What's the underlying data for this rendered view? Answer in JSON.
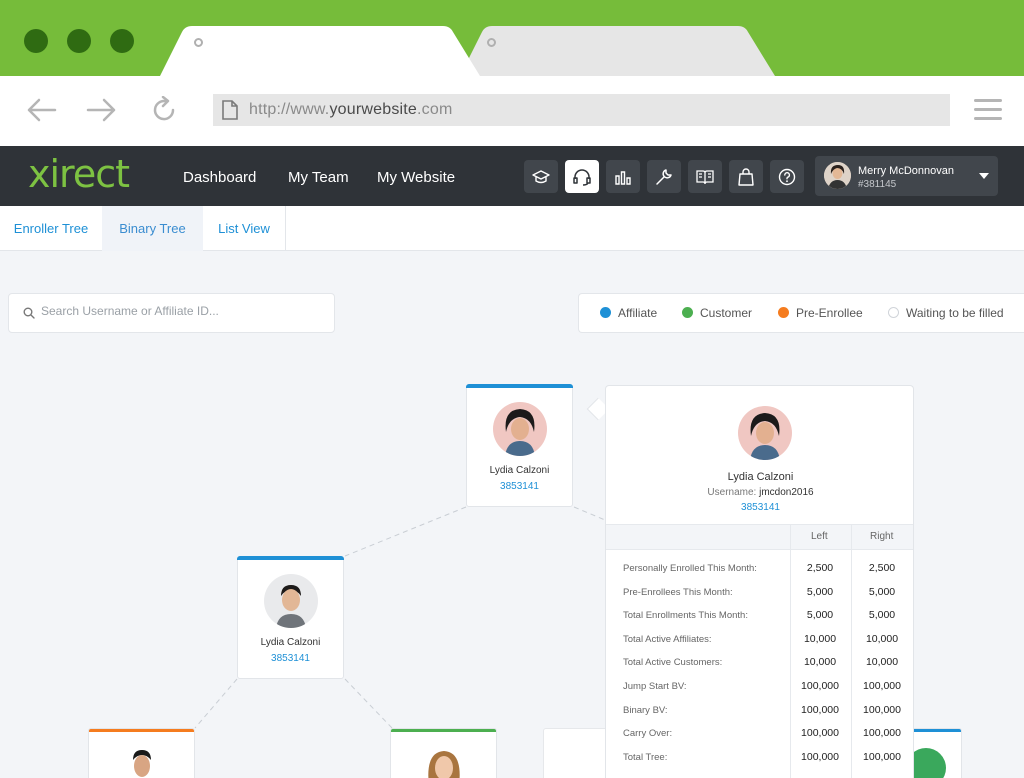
{
  "browser": {
    "url_prefix": "http://www.",
    "url_domain": "yourwebsite",
    "url_suffix": ".com"
  },
  "app": {
    "logo": "xirect",
    "nav": [
      "Dashboard",
      "My Team",
      "My Website"
    ],
    "icons": [
      "graduation-cap-icon",
      "headset-icon",
      "bar-chart-icon",
      "wrench-icon",
      "book-icon",
      "shopping-bag-icon",
      "help-icon"
    ],
    "active_icon": "headset-icon",
    "user": {
      "name": "Merry McDonnovan",
      "id": "#381145"
    }
  },
  "tabs": [
    "Enroller Tree",
    "Binary Tree",
    "List View"
  ],
  "active_tab": "Binary Tree",
  "search": {
    "placeholder": "Search Username or Affiliate ID..."
  },
  "legend": [
    {
      "label": "Affiliate",
      "color": "#1e90d6"
    },
    {
      "label": "Customer",
      "color": "#4caf50"
    },
    {
      "label": "Pre-Enrollee",
      "color": "#f57c1f"
    },
    {
      "label": "Waiting to be filled",
      "color": "#ffffff"
    }
  ],
  "tree": {
    "root": {
      "name": "Lydia Calzoni",
      "id": "3853141",
      "color": "#1e90d6"
    },
    "left": {
      "name": "Lydia Calzoni",
      "id": "3853141",
      "color": "#1e90d6"
    },
    "colors": {
      "pre_enrollee": "#f57c1f",
      "customer": "#4caf50",
      "affiliate": "#1e90d6"
    }
  },
  "popup": {
    "name": "Lydia Calzoni",
    "username_label": "Username:",
    "username": "jmcdon2016",
    "id": "3853141",
    "col_left": "Left",
    "col_right": "Right",
    "rows": [
      {
        "label": "Personally Enrolled This Month:",
        "left": "2,500",
        "right": "2,500"
      },
      {
        "label": "Pre-Enrollees This Month:",
        "left": "5,000",
        "right": "5,000"
      },
      {
        "label": "Total Enrollments This Month:",
        "left": "5,000",
        "right": "5,000"
      },
      {
        "label": "Total Active Affiliates:",
        "left": "10,000",
        "right": "10,000"
      },
      {
        "label": "Total Active Customers:",
        "left": "10,000",
        "right": "10,000"
      },
      {
        "label": "Jump Start BV:",
        "left": "100,000",
        "right": "100,000"
      },
      {
        "label": "Binary BV:",
        "left": "100,000",
        "right": "100,000"
      },
      {
        "label": "Carry Over:",
        "left": "100,000",
        "right": "100,000"
      },
      {
        "label": "Total Tree:",
        "left": "100,000",
        "right": "100,000"
      }
    ]
  }
}
